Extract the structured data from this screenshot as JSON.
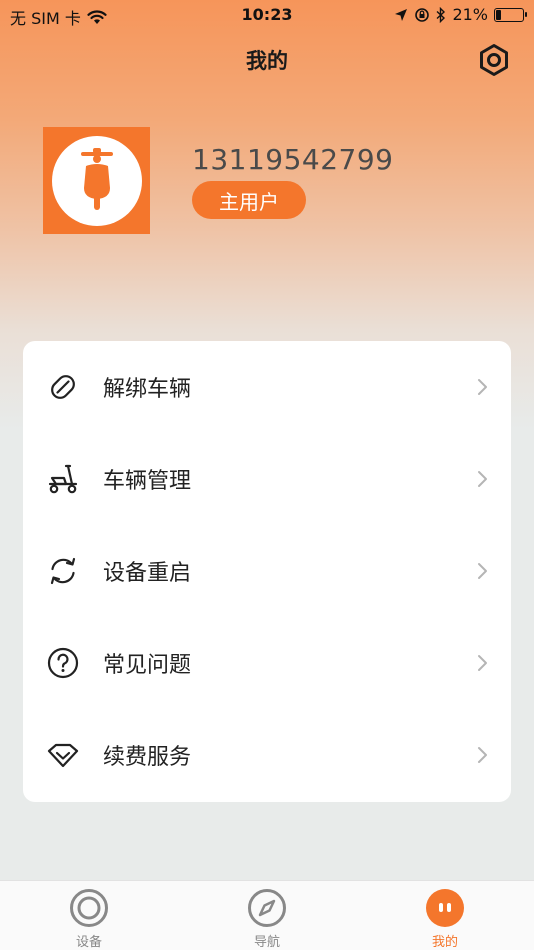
{
  "status_bar": {
    "carrier": "无 SIM 卡",
    "time": "10:23",
    "battery": "21%",
    "battery_level": 0.21
  },
  "header": {
    "title": "我的"
  },
  "profile": {
    "phone": "13119542799",
    "role": "主用户"
  },
  "menu": {
    "items": [
      {
        "label": "解绑车辆",
        "icon": "unlink-icon"
      },
      {
        "label": "车辆管理",
        "icon": "scooter-icon"
      },
      {
        "label": "设备重启",
        "icon": "refresh-icon"
      },
      {
        "label": "常见问题",
        "icon": "question-icon"
      },
      {
        "label": "续费服务",
        "icon": "diamond-icon"
      }
    ]
  },
  "tabbar": {
    "tabs": [
      {
        "label": "设备",
        "icon": "device-icon",
        "active": false
      },
      {
        "label": "导航",
        "icon": "compass-icon",
        "active": false
      },
      {
        "label": "我的",
        "icon": "mine-icon",
        "active": true
      }
    ]
  },
  "colors": {
    "accent": "#f4762c",
    "header_gradient_top": "#f6955a",
    "background": "#e8ebea"
  }
}
